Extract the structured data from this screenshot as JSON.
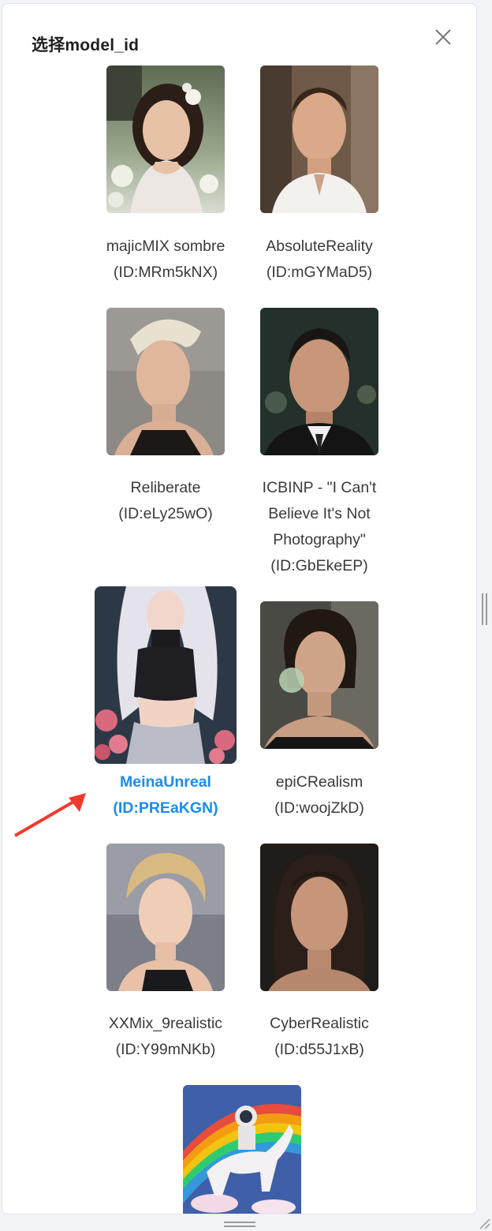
{
  "dialog": {
    "title": "选择model_id",
    "close_icon": "close-icon"
  },
  "models": [
    {
      "name": "majicMIX sombre",
      "id_label": "(ID:MRm5kNX)",
      "selected": false
    },
    {
      "name": "AbsoluteReality",
      "id_label": "(ID:mGYMaD5)",
      "selected": false
    },
    {
      "name": "Reliberate",
      "id_label": "(ID:eLy25wO)",
      "selected": false
    },
    {
      "name_lines": [
        "ICBINP - \"I Can't",
        "Believe It's Not",
        "Photography\""
      ],
      "id_label": "(ID:GbEkeEP)",
      "selected": false
    },
    {
      "name": "MeinaUnreal",
      "id_label": "(ID:PREaKGN)",
      "selected": true
    },
    {
      "name": "epiCRealism",
      "id_label": "(ID:woojZkD)",
      "selected": false
    },
    {
      "name": "XXMix_9realistic",
      "id_label": "(ID:Y99mNKb)",
      "selected": false
    },
    {
      "name": "CyberRealistic",
      "id_label": "(ID:d55J1xB)",
      "selected": false
    },
    {
      "name": "",
      "id_label": "",
      "selected": false
    }
  ],
  "colors": {
    "selected_text": "#1a8cf0",
    "annotation_arrow": "#f03a2e"
  }
}
